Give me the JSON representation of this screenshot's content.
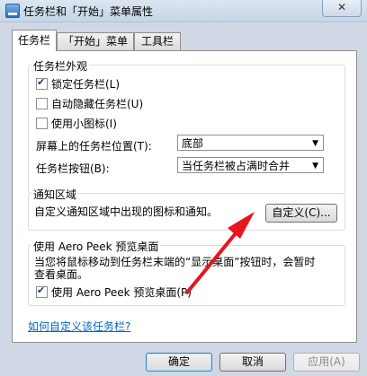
{
  "window": {
    "title": "任务栏和「开始」菜单属性",
    "close_glyph": "✕"
  },
  "tabs": [
    {
      "label": "任务栏",
      "active": true
    },
    {
      "label": "「开始」菜单",
      "active": false
    },
    {
      "label": "工具栏",
      "active": false
    }
  ],
  "appearance": {
    "title": "任务栏外观",
    "lock_taskbar": {
      "label": "锁定任务栏(L)",
      "checked": true
    },
    "auto_hide": {
      "label": "自动隐藏任务栏(U)",
      "checked": false
    },
    "small_icons": {
      "label": "使用小图标(I)",
      "checked": false
    },
    "location_label": "屏幕上的任务栏位置(T):",
    "location_value": "底部",
    "buttons_label": "任务栏按钮(B):",
    "buttons_value": "当任务栏被占满时合并"
  },
  "notification": {
    "title": "通知区域",
    "description": "自定义通知区域中出现的图标和通知。",
    "customize_button": "自定义(C)..."
  },
  "aero_peek": {
    "title": "使用 Aero Peek 预览桌面",
    "description_line1": "当您将鼠标移动到任务栏末端的“显示桌面”按钮时，会暂时",
    "description_line2": "查看桌面。",
    "checkbox": {
      "label": "使用 Aero Peek 预览桌面(P)",
      "checked": true
    }
  },
  "help_link": "如何自定义该任务栏?",
  "footer": {
    "ok": "确定",
    "cancel": "取消",
    "apply": "应用(A)"
  },
  "colors": {
    "annotation_arrow": "#e8141e",
    "link": "#0066cc"
  }
}
